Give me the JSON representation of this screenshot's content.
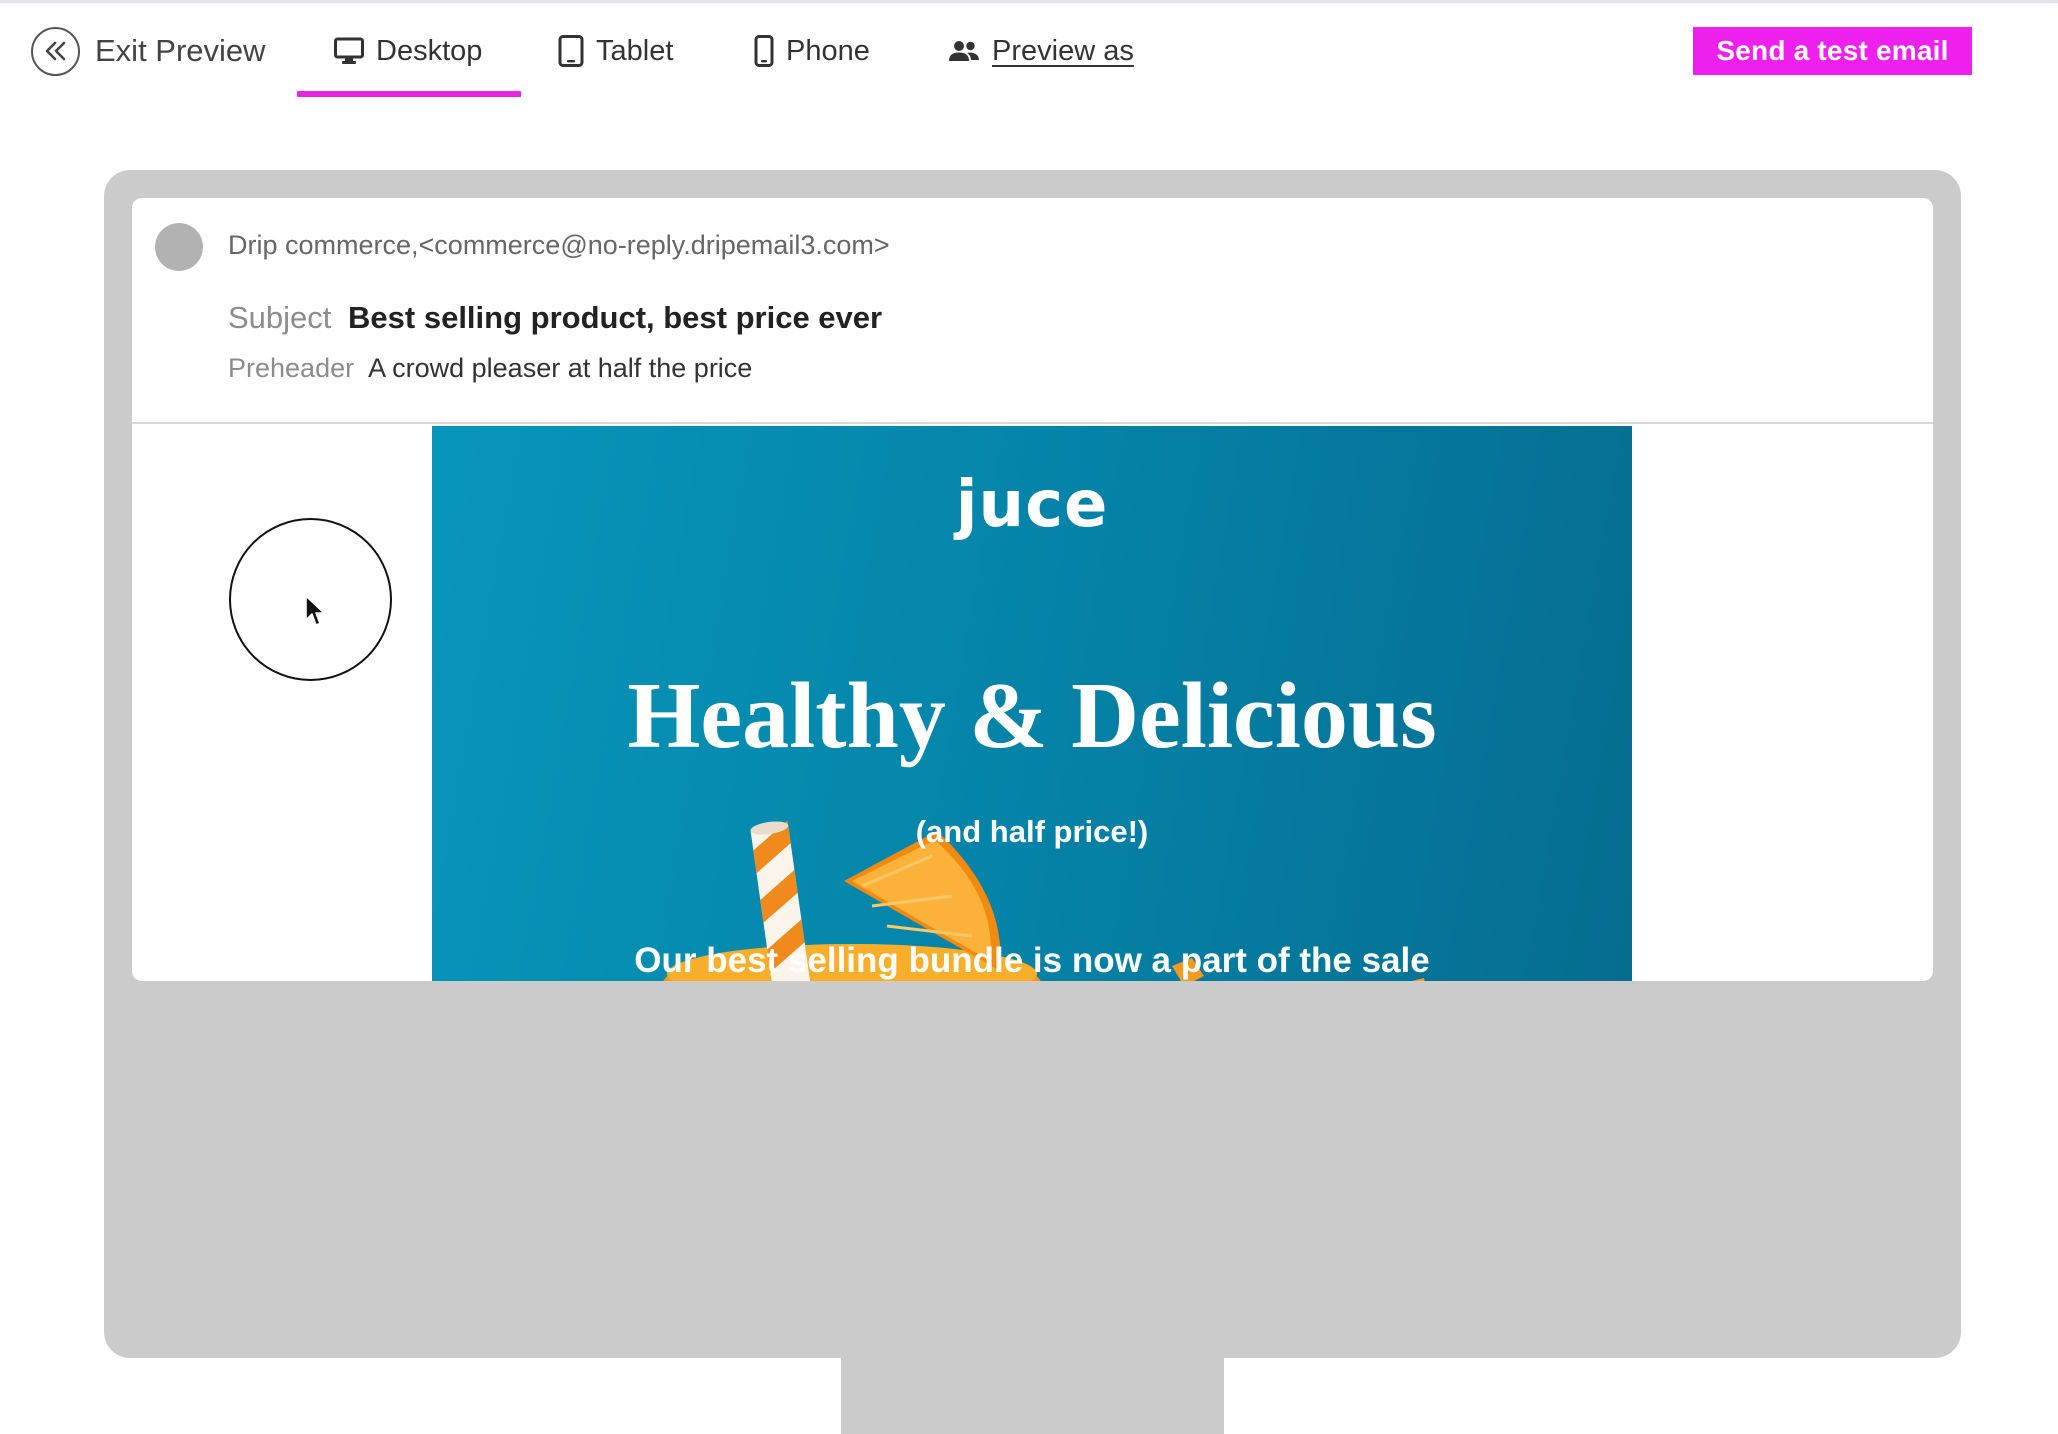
{
  "toolbar": {
    "exit_label": "Exit Preview",
    "tabs": [
      {
        "label": "Desktop",
        "active": true
      },
      {
        "label": "Tablet"
      },
      {
        "label": "Phone"
      },
      {
        "label": "Preview as"
      }
    ],
    "send_label": "Send a test email",
    "accent_color": "#ee20ee"
  },
  "email": {
    "from": "Drip commerce,<commerce@no-reply.dripemail3.com>",
    "subject_label": "Subject",
    "subject": "Best selling product, best price ever",
    "preheader_label": "Preheader",
    "preheader": "A crowd pleaser at half the price"
  },
  "hero": {
    "logo": "juce",
    "headline": "Healthy & Delicious",
    "subheadline": "(and half price!)",
    "tagline": "Our best selling bundle is now a part of the sale",
    "background_color": "#0585aa"
  },
  "icons": {
    "exit": "double-chevron-left-icon",
    "desktop": "desktop-icon",
    "tablet": "tablet-icon",
    "phone": "phone-icon",
    "preview_as": "people-icon",
    "cursor": "mouse-pointer-icon"
  }
}
